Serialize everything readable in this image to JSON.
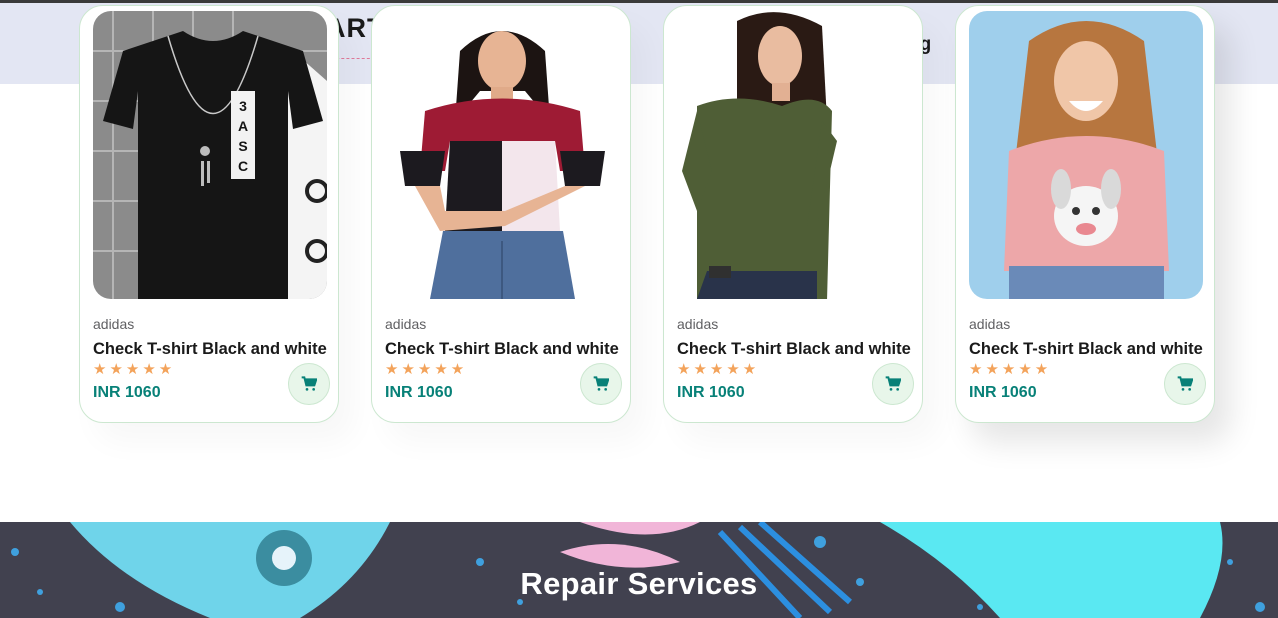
{
  "header": {
    "logo_text": "ART",
    "nav_partial": "og"
  },
  "products": [
    {
      "brand": "adidas",
      "name": "Check T-shirt Black and white",
      "rating": 5,
      "stars": "★★★★★",
      "price": "INR 1060",
      "image": "black-basic-tshirt-hanger"
    },
    {
      "brand": "adidas",
      "name": "Check T-shirt Black and white",
      "rating": 5,
      "stars": "★★★★★",
      "price": "INR 1060",
      "image": "woman-maroon-black-white-top"
    },
    {
      "brand": "adidas",
      "name": "Check T-shirt Black and white",
      "rating": 5,
      "stars": "★★★★★",
      "price": "INR 1060",
      "image": "woman-olive-green-top"
    },
    {
      "brand": "adidas",
      "name": "Check T-shirt Black and white",
      "rating": 5,
      "stars": "★★★★★",
      "price": "INR 1060",
      "image": "woman-pink-bugs-bunny-tee"
    }
  ],
  "banner": {
    "title": "Repair Services"
  },
  "colors": {
    "header_bg": "#e3e6f3",
    "accent": "#088178",
    "star": "#f3a35b",
    "cart_bg": "#e8f6ea",
    "banner_bg": "#41414f"
  },
  "icons": {
    "cart": "cart-icon",
    "star": "star-icon"
  }
}
